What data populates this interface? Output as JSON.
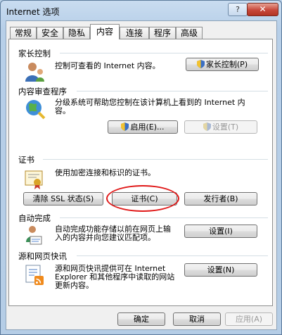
{
  "window": {
    "title": "Internet 选项",
    "help_label": "?",
    "close_label": "✕"
  },
  "tabs": [
    {
      "label": "常规"
    },
    {
      "label": "安全"
    },
    {
      "label": "隐私"
    },
    {
      "label": "内容",
      "active": true
    },
    {
      "label": "连接"
    },
    {
      "label": "程序"
    },
    {
      "label": "高级"
    }
  ],
  "parental": {
    "title": "家长控制",
    "description": "控制可查看的 Internet 内容。",
    "button_label": "家长控制(P)"
  },
  "content_advisor": {
    "title": "内容审查程序",
    "description_line1": "分级系统可帮助您控制在该计算机上看到的 Internet 内",
    "description_line2": "容。",
    "enable_label": "启用(E)...",
    "settings_label": "设置(T)"
  },
  "certificates": {
    "title": "证书",
    "description": "使用加密连接和标识的证书。",
    "clear_ssl_label": "清除 SSL 状态(S)",
    "certificates_label": "证书(C)",
    "publishers_label": "发行者(B)"
  },
  "autocomplete": {
    "title": "自动完成",
    "description_line1": "自动完成功能存储以前在网页上输",
    "description_line2": "入的内容并向您建议匹配项。",
    "settings_label": "设置(I)"
  },
  "feeds": {
    "title": "源和网页快讯",
    "description_line1": "源和网页快讯提供可在 Internet",
    "description_line2": "Explorer 和其他程序中读取的网站",
    "description_line3": "更新内容。",
    "settings_label": "设置(N)"
  },
  "footer": {
    "ok_label": "确定",
    "cancel_label": "取消",
    "apply_label": "应用(A)"
  },
  "colors": {
    "highlight_ellipse": "#e01818",
    "title_gradient": "#b7cfe8",
    "close_button": "#c7473a"
  }
}
